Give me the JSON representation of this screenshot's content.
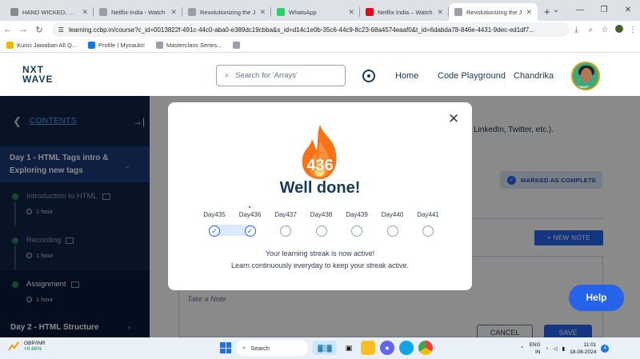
{
  "browser": {
    "tabs": [
      {
        "title": "HAND WICKED, HAND",
        "favicon_color": "#8a8a8a",
        "active": false
      },
      {
        "title": "Netflix-India - Watch",
        "favicon_color": "#9aa0a6",
        "active": false
      },
      {
        "title": "Revolutionizing the J",
        "favicon_color": "#9aa0a6",
        "active": false
      },
      {
        "title": "WhatsApp",
        "favicon_color": "#25d366",
        "active": false
      },
      {
        "title": "Netflix India – Watch",
        "favicon_color": "#e50914",
        "active": false
      },
      {
        "title": "Revolutionizing the J",
        "favicon_color": "#9aa0a6",
        "active": true
      }
    ],
    "url": "learning.ccbp.in/course?c_id=0013822f-491c-44c0-aba0-e389dc19cbba&s_id=d14c1e0b-35c6-44c9-8c23-68a4574eaaf0&t_id=6dabda78-846e-4431-9dec-ed1df7...",
    "bookmarks": [
      {
        "label": "Kunci Jawaban All Q...",
        "color": "#f4b400"
      },
      {
        "label": "Profile | Mynaukri",
        "color": "#1a73e8"
      },
      {
        "label": "Masterclass Series...",
        "color": "#9aa0a6"
      },
      {
        "label": "",
        "color": "#9aa0a6"
      }
    ]
  },
  "header": {
    "logo_line1": "NXT",
    "logo_line2": "WAVE",
    "search_placeholder": "Search for 'Arrays'",
    "nav": [
      "Home",
      "Code Playground",
      "Chandrika"
    ],
    "avatar_caption": "SMART"
  },
  "sidebar": {
    "heading": "CONTENTS",
    "collapse_icon": "→|",
    "day1_title": "Day 1 - HTML Tags intro & Exploring new tags",
    "lessons": [
      {
        "title": "Introduction to HTML",
        "duration": "1 hour"
      },
      {
        "title": "Recording",
        "duration": "1 hour"
      },
      {
        "title": "Assignment",
        "duration": "1 hour"
      }
    ],
    "day2_title": "Day 2 - HTML Structure"
  },
  "main": {
    "text_fragment": "LinkedIn, Twitter, etc.).",
    "marked_label": "MARKED AS COMPLETE",
    "new_note_label": "+ NEW NOTE",
    "note_placeholder": "Take a Note",
    "cancel_label": "CANCEL",
    "save_label": "SAVE",
    "help_label": "Help"
  },
  "modal": {
    "streak_count": "436",
    "heading": "Well done!",
    "days": [
      {
        "label": "Day435",
        "done": true
      },
      {
        "label": "Day436",
        "done": true
      },
      {
        "label": "Day437",
        "done": false
      },
      {
        "label": "Day438",
        "done": false
      },
      {
        "label": "Day439",
        "done": false
      },
      {
        "label": "Day440",
        "done": false
      },
      {
        "label": "Day441",
        "done": false
      }
    ],
    "message_line1": "Your learning streak is now active!",
    "message_line2": "Learn continuously everyday to keep your streak active."
  },
  "taskbar": {
    "widget_title": "GBP/INR",
    "widget_value": "+0.66%",
    "search_label": "Search",
    "lang_line1": "ENG",
    "lang_line2": "IN",
    "time": "11:01",
    "date": "18-08-2024",
    "notification_count": "4"
  }
}
